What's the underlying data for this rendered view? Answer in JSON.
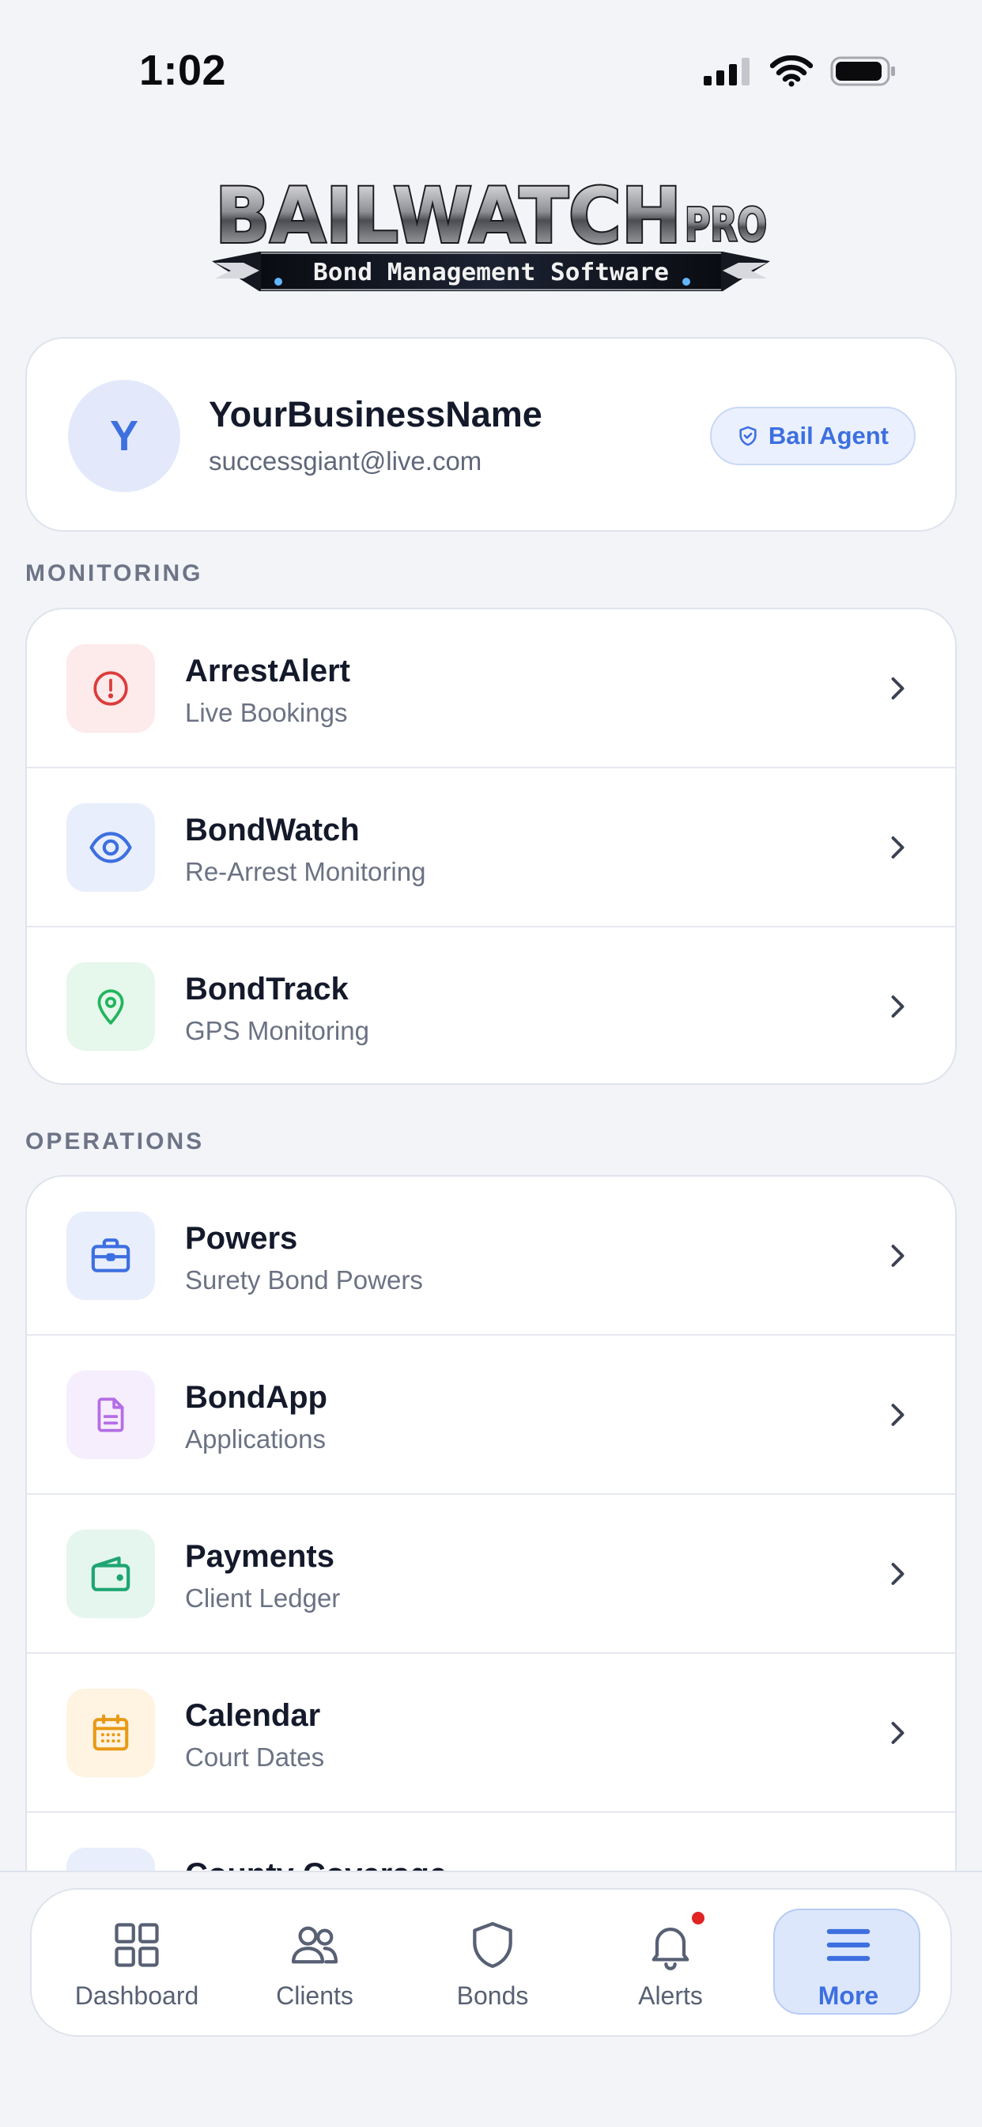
{
  "status_bar": {
    "time": "1:02"
  },
  "logo": {
    "wordmark": "BAILWATCH",
    "suffix": "PRO",
    "tagline": "Bond Management Software"
  },
  "profile": {
    "avatar_initial": "Y",
    "name": "YourBusinessName",
    "email": "successgiant@live.com",
    "role": "Bail Agent"
  },
  "sections": {
    "monitoring": {
      "heading": "MONITORING",
      "items": [
        {
          "title": "ArrestAlert",
          "subtitle": "Live Bookings",
          "icon": "alert-circle-icon",
          "color": "#dc3b3b",
          "bg": "#fdeaea"
        },
        {
          "title": "BondWatch",
          "subtitle": "Re-Arrest Monitoring",
          "icon": "eye-icon",
          "color": "#3d6fe0",
          "bg": "#e8eefc"
        },
        {
          "title": "BondTrack",
          "subtitle": "GPS Monitoring",
          "icon": "map-pin-icon",
          "color": "#22b55e",
          "bg": "#e6f7ec"
        }
      ]
    },
    "operations": {
      "heading": "OPERATIONS",
      "items": [
        {
          "title": "Powers",
          "subtitle": "Surety Bond Powers",
          "icon": "briefcase-icon",
          "color": "#3d6fe0",
          "bg": "#e8eefc"
        },
        {
          "title": "BondApp",
          "subtitle": "Applications",
          "icon": "document-icon",
          "color": "#b46ee6",
          "bg": "#f6edfd"
        },
        {
          "title": "Payments",
          "subtitle": "Client Ledger",
          "icon": "wallet-icon",
          "color": "#1fa574",
          "bg": "#e4f6ee"
        },
        {
          "title": "Calendar",
          "subtitle": "Court Dates",
          "icon": "calendar-icon",
          "color": "#e79a16",
          "bg": "#fff3e2"
        },
        {
          "title": "County Coverage",
          "subtitle": "",
          "icon": "map-icon",
          "color": "#3d6fe0",
          "bg": "#e8eefc"
        }
      ]
    }
  },
  "tabbar": {
    "tabs": [
      {
        "label": "Dashboard",
        "icon": "grid-icon"
      },
      {
        "label": "Clients",
        "icon": "users-icon"
      },
      {
        "label": "Bonds",
        "icon": "shield-icon"
      },
      {
        "label": "Alerts",
        "icon": "bell-icon",
        "has_badge": true
      },
      {
        "label": "More",
        "icon": "menu-icon",
        "active": true
      }
    ]
  },
  "colors": {
    "accent": "#3d6fe0",
    "alert_badge": "#e02424",
    "background": "#f2f4f8"
  }
}
